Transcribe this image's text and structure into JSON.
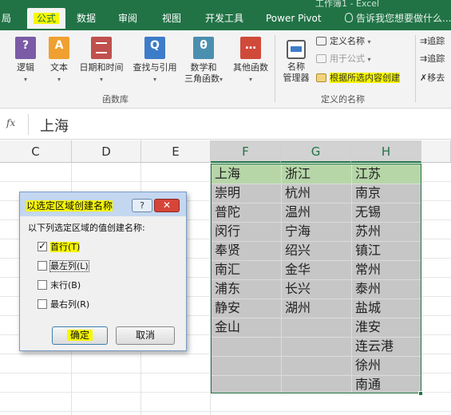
{
  "tabs": {
    "t0": "局",
    "formula": "公式",
    "data": "数据",
    "review": "审阅",
    "view": "视图",
    "developer": "开发工具",
    "powerpivot": "Power Pivot",
    "tellme": "告诉我您想要做什么...",
    "window_title_fragment": "工作簿1 - Excel"
  },
  "ribbon": {
    "logic": "逻辑",
    "text": "文本",
    "datetime": "日期和时间",
    "lookup": "查找与引用",
    "math_line1": "数学和",
    "math_line2": "三角函数",
    "more": "其他函数",
    "group_library": "函数库",
    "name_mgr_line1": "名称",
    "name_mgr_line2": "管理器",
    "define_name": "定义名称",
    "use_in_formula": "用于公式",
    "create_from_sel": "根据所选内容创建",
    "group_names": "定义的名称",
    "trace1": "追踪",
    "trace2": "追踪",
    "remove": "移去"
  },
  "formula_bar": {
    "fx": "fx",
    "content": "上海"
  },
  "columns": [
    "C",
    "D",
    "E",
    "F",
    "G",
    "H"
  ],
  "table": {
    "F": [
      "上海",
      "崇明",
      "普陀",
      "闵行",
      "奉贤",
      "南汇",
      "浦东",
      "静安",
      "金山"
    ],
    "G": [
      "浙江",
      "杭州",
      "温州",
      "宁海",
      "绍兴",
      "金华",
      "长兴",
      "湖州"
    ],
    "H": [
      "江苏",
      "南京",
      "无锡",
      "苏州",
      "镇江",
      "常州",
      "泰州",
      "盐城",
      "淮安",
      "连云港",
      "徐州",
      "南通"
    ]
  },
  "dialog": {
    "title": "以选定区域创建名称",
    "help": "?",
    "close": "✕",
    "prompt": "以下列选定区域的值创建名称:",
    "options": [
      {
        "label": "首行(T)",
        "checked": true
      },
      {
        "label": "最左列(L)",
        "checked": false
      },
      {
        "label": "末行(B)",
        "checked": false
      },
      {
        "label": "最右列(R)",
        "checked": false
      }
    ],
    "ok": "确定",
    "cancel": "取消"
  },
  "colors": {
    "excel_green": "#217346",
    "highlight": "#f7f700",
    "header_green": "#b6d6a8",
    "selection_gray": "#c6c6c6"
  }
}
